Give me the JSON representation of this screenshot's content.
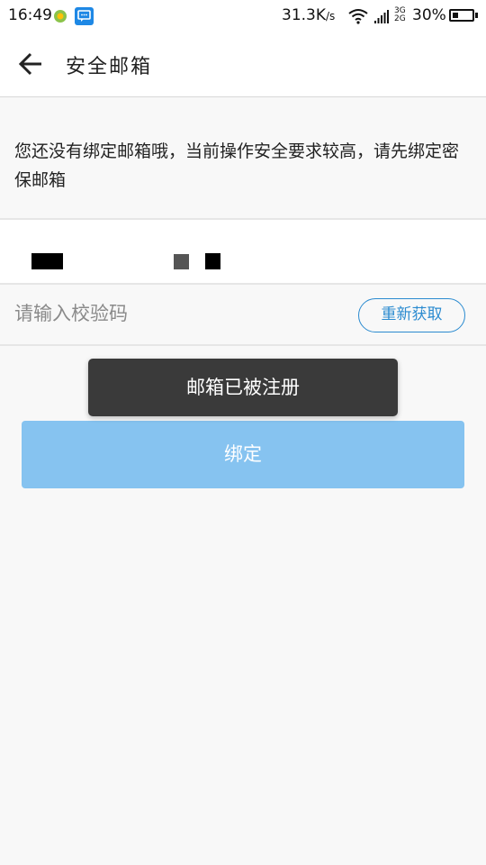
{
  "status_bar": {
    "time": "16:49",
    "app_icons": [
      "app-notification-icon",
      "message-icon"
    ],
    "net_speed": "31.3K",
    "net_speed_unit": "/s",
    "network_types": [
      "3G",
      "2G"
    ],
    "battery_percent_label": "30%",
    "battery_level": 0.3
  },
  "header": {
    "back_icon": "arrow-left-icon",
    "title": "安全邮箱"
  },
  "notice": "您还没有绑定邮箱哦，当前操作安全要求较高，请先绑定密保邮箱",
  "code_input": {
    "value": "",
    "placeholder": "请输入校验码"
  },
  "resend_label": "重新获取",
  "toast": "邮箱已被注册",
  "bind_label": "绑定",
  "colors": {
    "accent": "#2b8bd0",
    "bind_button": "#86c3f0",
    "toast_bg": "#3a3a3a",
    "page_bg": "#f8f8f8"
  }
}
